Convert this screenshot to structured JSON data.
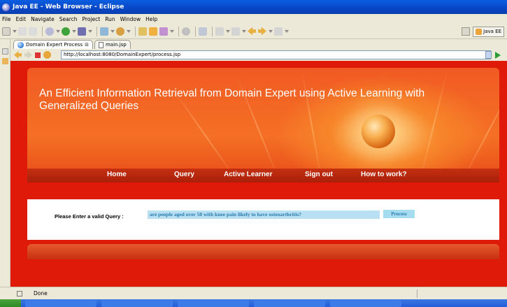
{
  "window": {
    "title": "Java EE - Web Browser - Eclipse"
  },
  "menu": [
    "File",
    "Edit",
    "Navigate",
    "Search",
    "Project",
    "Run",
    "Window",
    "Help"
  ],
  "perspective": {
    "label": "Java EE"
  },
  "tabs": [
    {
      "label": "Domain Expert Process",
      "active": true,
      "close": "⊠"
    },
    {
      "label": "main.jsp",
      "active": false
    }
  ],
  "browser": {
    "url": "http://localhost:8080/DomainExpert/process.jsp"
  },
  "page": {
    "headline": "An Efficient Information Retrieval from Domain Expert using Active Learning with Generalized Queries",
    "nav": [
      "Home",
      "Query",
      "Active Learner",
      "Sign out",
      "How to work?"
    ],
    "query_label": "Please Enter a valid Query :",
    "query_value": "are people aged over 50 with knee pain likely to have osteoarthritis?",
    "process_button": "Process",
    "colors": {
      "page_bg": "#e01a08",
      "banner": "#f15a23",
      "nav_strip": "#b8260c"
    }
  },
  "status": {
    "text": "Done"
  }
}
